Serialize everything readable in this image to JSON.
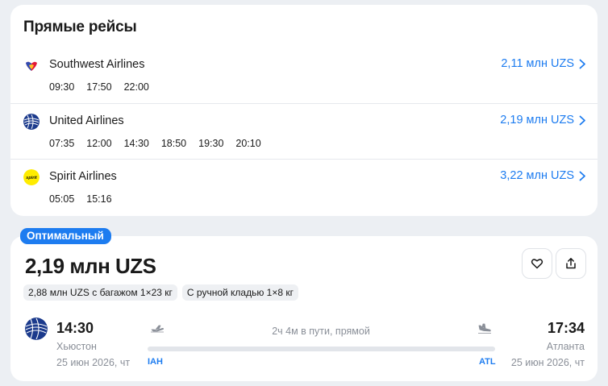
{
  "direct": {
    "title": "Прямые рейсы",
    "airlines": [
      {
        "name": "Southwest Airlines",
        "price": "2,11 млн UZS",
        "times": [
          "09:30",
          "17:50",
          "22:00"
        ],
        "logo_icon": "southwest-logo-icon"
      },
      {
        "name": "United Airlines",
        "price": "2,19 млн UZS",
        "times": [
          "07:35",
          "12:00",
          "14:30",
          "18:50",
          "19:30",
          "20:10"
        ],
        "logo_icon": "united-logo-icon"
      },
      {
        "name": "Spirit Airlines",
        "price": "3,22 млн UZS",
        "times": [
          "05:05",
          "15:16"
        ],
        "logo_icon": "spirit-logo-icon",
        "logo_text": "spirit"
      }
    ]
  },
  "offer": {
    "badge": "Оптимальный",
    "price": "2,19 млн UZS",
    "chips": [
      "2,88 млн UZS с багажом 1×23 кг",
      "С ручной кладью 1×8 кг"
    ],
    "departure": {
      "time": "14:30",
      "city": "Хьюстон",
      "date": "25 июн 2026, чт",
      "iata": "IAH"
    },
    "arrival": {
      "time": "17:34",
      "city": "Атланта",
      "date": "25 июн 2026, чт",
      "iata": "ATL"
    },
    "duration": "2ч 4м в пути, прямой"
  },
  "colors": {
    "accent": "#1d7cf0",
    "background": "#eceff3",
    "muted": "#8a8f98"
  }
}
